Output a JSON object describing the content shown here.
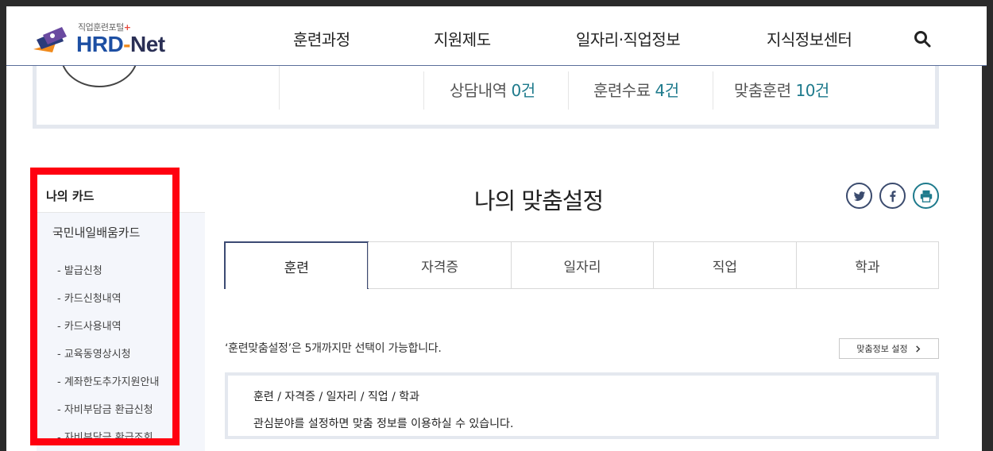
{
  "header": {
    "logo_sub": "직업훈련포털",
    "logo_hrd": "HRD",
    "logo_dash": "-",
    "logo_net": "Net",
    "nav": [
      "훈련과정",
      "지원제도",
      "일자리·직업정보",
      "지식정보센터"
    ],
    "search_icon": "search-icon"
  },
  "summary": {
    "stats": [
      {
        "label": "상담내역 ",
        "value": "0건"
      },
      {
        "label": "훈련수료 ",
        "value": "4건"
      },
      {
        "label": "맞춤훈련 ",
        "value": "10건"
      }
    ]
  },
  "sidebar": {
    "title": "나의 카드",
    "group_title": "국민내일배움카드",
    "items": [
      "- 발급신청",
      "- 카드신청내역",
      "- 카드사용내역",
      "- 교육동영상시청",
      "- 계좌한도추가지원안내",
      "- 자비부담금 환급신청",
      "- 자비부담금 환급조회"
    ]
  },
  "main": {
    "title": "나의 맞춤설정",
    "share_icons": [
      "twitter-icon",
      "facebook-icon",
      "print-icon"
    ],
    "tabs": [
      "훈련",
      "자격증",
      "일자리",
      "직업",
      "학과"
    ],
    "notice": "‘훈련맞춤설정’은 5개까지만 선택이 가능합니다.",
    "setting_button": "맞춤정보 설정",
    "info_line1": "훈련 / 자격증 / 일자리 / 직업 / 학과",
    "info_line2": "관심분야를 설정하면 맞춤 정보를 이용하실 수 있습니다."
  },
  "colors": {
    "accent_teal": "#1e7a8c",
    "nav_border": "#3c4a73",
    "highlight_red": "#ff0010"
  }
}
